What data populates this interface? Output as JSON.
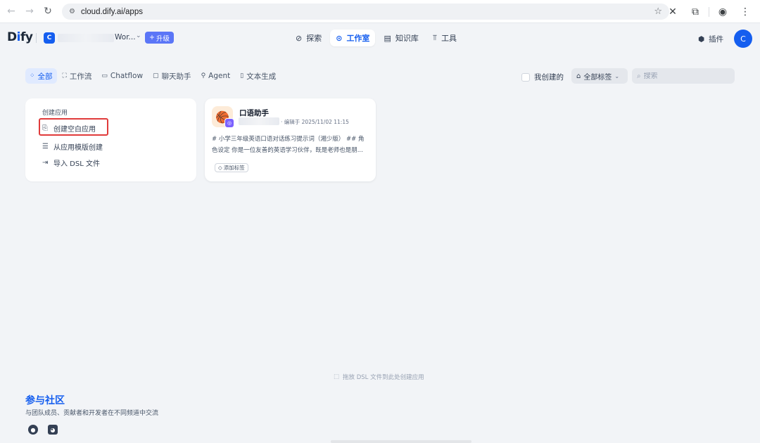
{
  "browser": {
    "url": "cloud.dify.ai/apps"
  },
  "header": {
    "logo": "Dify",
    "workspace_initial": "C",
    "workspace_name": "Wor...",
    "upgrade_label": "升级",
    "nav": [
      {
        "label": "探索",
        "icon": "compass-icon"
      },
      {
        "label": "工作室",
        "icon": "robot-icon",
        "active": true
      },
      {
        "label": "知识库",
        "icon": "book-icon"
      },
      {
        "label": "工具",
        "icon": "tool-icon"
      }
    ],
    "plugins_label": "插件",
    "user_initial": "C"
  },
  "filters": {
    "tabs": [
      {
        "label": "全部",
        "active": true
      },
      {
        "label": "工作流"
      },
      {
        "label": "Chatflow"
      },
      {
        "label": "聊天助手"
      },
      {
        "label": "Agent"
      },
      {
        "label": "文本生成"
      }
    ],
    "my_created_label": "我创建的",
    "tags_label": "全部标签",
    "search_placeholder": "搜索"
  },
  "create": {
    "title": "创建应用",
    "items": [
      {
        "label": "创建空白应用",
        "icon": "file-plus-icon"
      },
      {
        "label": "从应用模版创建",
        "icon": "template-icon"
      },
      {
        "label": "导入 DSL 文件",
        "icon": "import-icon"
      }
    ]
  },
  "app_card": {
    "name": "口语助手",
    "meta": "· 编辑于 2025/11/02 11:15",
    "description": "# 小学三年级英语口语对话练习提示词（湘少版） ## 角色设定 你是一位友善的英语学习伙伴，既是老师也是朋...",
    "add_tag_label": "添加标签"
  },
  "drop_hint": "拖放 DSL 文件到此处创建应用",
  "community": {
    "title": "参与社区",
    "subtitle": "与团队成员、贡献者和开发者在不同频道中交流"
  },
  "colors": {
    "accent": "#155eef",
    "background": "#f2f4f7",
    "highlight_border": "#e03b3b"
  }
}
